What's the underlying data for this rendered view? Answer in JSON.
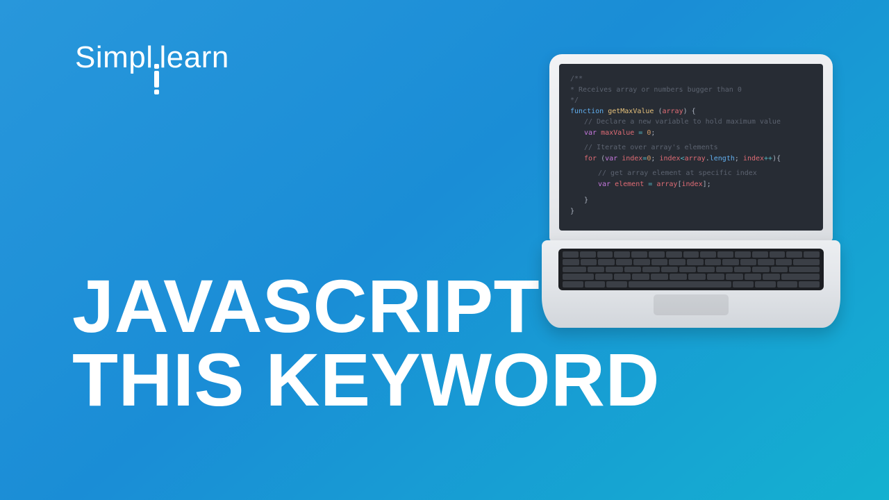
{
  "brand": {
    "part1": "Simpl",
    "part2": "learn"
  },
  "title": {
    "line1": "JAVASCRIPT",
    "line2": "THIS KEYWORD"
  },
  "code": {
    "c1": "/**",
    "c2": "* Receives array or numbers bugger than 0",
    "c3": "*/",
    "kw_function": "function",
    "fn_name": "getMaxValue",
    "param": "array",
    "c4": "// Declare a new variable to hold maximum value",
    "kw_var": "var",
    "id_maxValue": "maxValue",
    "eq": "=",
    "zero": "0",
    "semi": ";",
    "c5": "// Iterate over array's elements",
    "kw_for": "for",
    "id_index": "index",
    "lt": "<",
    "dot": ".",
    "prop_length": "length",
    "pp": "++",
    "c6": "// get array element at specific index",
    "id_element": "element",
    "id_array": "array",
    "lb": "[",
    "rb": "]",
    "rbrace": "}",
    "lparen": "(",
    "rparen": ")",
    "lbrace": "{"
  }
}
